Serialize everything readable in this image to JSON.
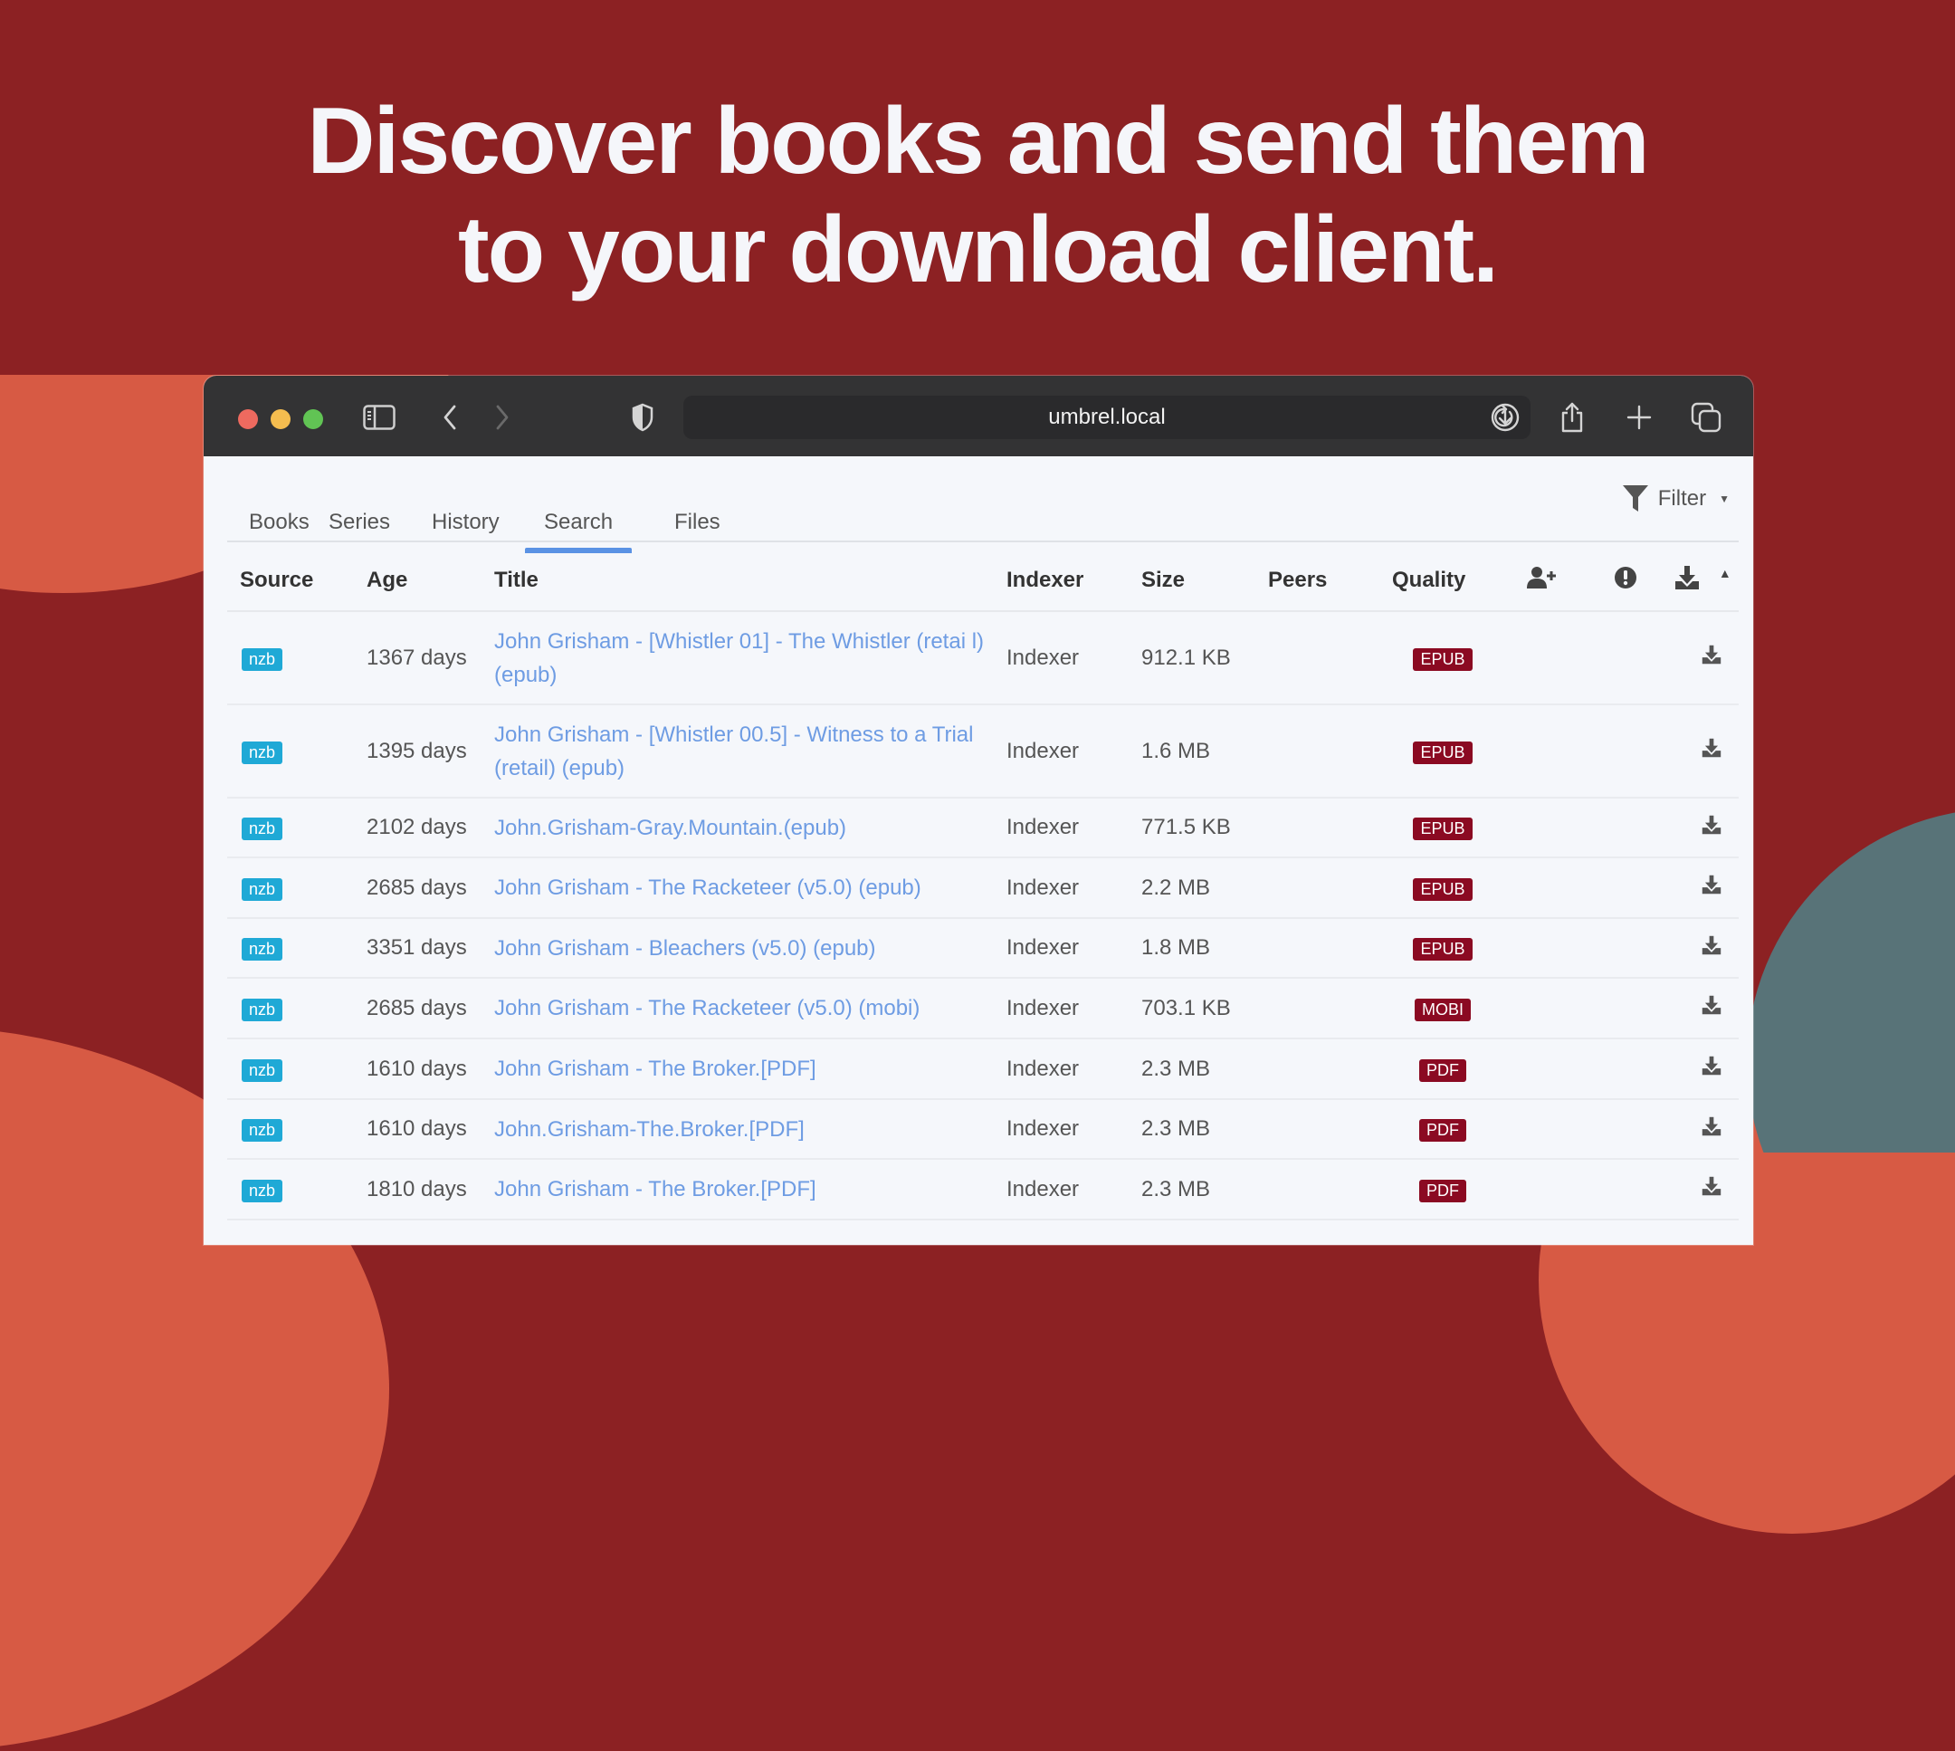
{
  "headline": {
    "line1": "Discover books and send them",
    "line2": "to your download client."
  },
  "browser": {
    "url": "umbrel.local",
    "traffic_lights": [
      "#ee6a5f",
      "#f5bd4f",
      "#61c454"
    ],
    "icons": [
      "sidebar-icon",
      "back-icon",
      "forward-icon",
      "shield-icon",
      "reload-icon",
      "downloads-icon",
      "share-icon",
      "new-tab-icon",
      "tabs-overview-icon"
    ]
  },
  "app": {
    "tabs": [
      {
        "label": "Books",
        "active": false
      },
      {
        "label": "Series",
        "active": false
      },
      {
        "label": "History",
        "active": false
      },
      {
        "label": "Search",
        "active": true
      },
      {
        "label": "Files",
        "active": false
      }
    ],
    "filter_label": "Filter",
    "columns": [
      "Source",
      "Age",
      "Title",
      "Indexer",
      "Size",
      "Peers",
      "Quality"
    ],
    "icon_columns": [
      "add-person-icon",
      "alert-icon",
      "download-icon"
    ],
    "rows": [
      {
        "source": "nzb",
        "age": "1367 days",
        "title": "John Grisham - [Whistler 01] - The Whistler (retai l) (epub)",
        "indexer": "Indexer",
        "size": "912.1 KB",
        "peers": "",
        "quality": "EPUB"
      },
      {
        "source": "nzb",
        "age": "1395 days",
        "title": "John Grisham - [Whistler 00.5] - Witness to a Trial (retail) (epub)",
        "indexer": "Indexer",
        "size": "1.6 MB",
        "peers": "",
        "quality": "EPUB"
      },
      {
        "source": "nzb",
        "age": "2102 days",
        "title": "John.Grisham-Gray.Mountain.(epub)",
        "indexer": "Indexer",
        "size": "771.5 KB",
        "peers": "",
        "quality": "EPUB"
      },
      {
        "source": "nzb",
        "age": "2685 days",
        "title": "John Grisham - The Racketeer (v5.0) (epub)",
        "indexer": "Indexer",
        "size": "2.2 MB",
        "peers": "",
        "quality": "EPUB"
      },
      {
        "source": "nzb",
        "age": "3351 days",
        "title": "John Grisham - Bleachers (v5.0) (epub)",
        "indexer": "Indexer",
        "size": "1.8 MB",
        "peers": "",
        "quality": "EPUB"
      },
      {
        "source": "nzb",
        "age": "2685 days",
        "title": "John Grisham - The Racketeer (v5.0) (mobi)",
        "indexer": "Indexer",
        "size": "703.1 KB",
        "peers": "",
        "quality": "MOBI"
      },
      {
        "source": "nzb",
        "age": "1610 days",
        "title": "John Grisham - The Broker.[PDF]",
        "indexer": "Indexer",
        "size": "2.3 MB",
        "peers": "",
        "quality": "PDF"
      },
      {
        "source": "nzb",
        "age": "1610 days",
        "title": "John.Grisham-The.Broker.[PDF]",
        "indexer": "Indexer",
        "size": "2.3 MB",
        "peers": "",
        "quality": "PDF"
      },
      {
        "source": "nzb",
        "age": "1810 days",
        "title": "John Grisham - The Broker.[PDF]",
        "indexer": "Indexer",
        "size": "2.3 MB",
        "peers": "",
        "quality": "PDF"
      }
    ]
  },
  "colors": {
    "background": "#8c2123",
    "accent_orange": "#d75a44",
    "accent_teal": "#587378",
    "nzb_badge": "#1fa9d6",
    "quality_badge": "#8b0a22",
    "link": "#6e9ce3",
    "tab_underline": "#5a92e4"
  }
}
